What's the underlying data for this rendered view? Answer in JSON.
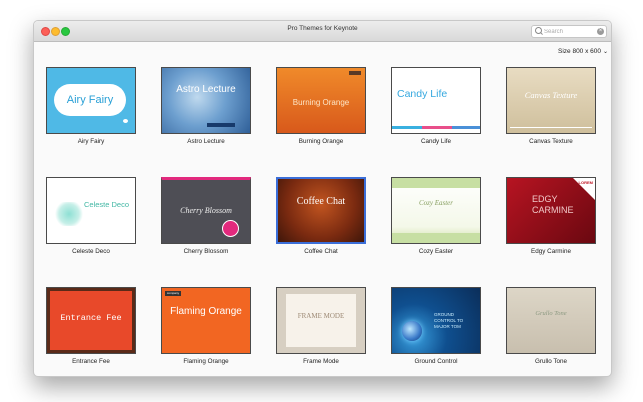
{
  "window": {
    "title": "Pro Themes for Keynote"
  },
  "search": {
    "placeholder": "Search"
  },
  "size_selector": {
    "label": "Size 800 x 600"
  },
  "themes": [
    {
      "name": "Airy Fairy",
      "slide_text": "Airy Fairy"
    },
    {
      "name": "Astro Lecture",
      "slide_text": "Astro Lecture"
    },
    {
      "name": "Burning Orange",
      "slide_text": "Burning Orange"
    },
    {
      "name": "Candy Life",
      "slide_text": "Candy Life"
    },
    {
      "name": "Canvas Texture",
      "slide_text": "Canvas Texture"
    },
    {
      "name": "Celeste Deco",
      "slide_text": "Celeste Deco"
    },
    {
      "name": "Cherry Blossom",
      "slide_text": "Cherry Blossom"
    },
    {
      "name": "Coffee Chat",
      "slide_text": "Coffee Chat",
      "selected": true
    },
    {
      "name": "Cozy Easter",
      "slide_text": "Cozy Easter"
    },
    {
      "name": "Edgy Carmine",
      "slide_text": "EDGY CARMINE",
      "corner_label": "LOREM"
    },
    {
      "name": "Entrance Fee",
      "slide_text": "Entrance Fee"
    },
    {
      "name": "Flaming Orange",
      "slide_text": "Flaming Orange",
      "tag_label": "company"
    },
    {
      "name": "Frame Mode",
      "slide_text": "FRAME MODE"
    },
    {
      "name": "Ground Control",
      "slide_text": "GROUND CONTROL TO MAJOR TOM"
    },
    {
      "name": "Grullo Tone",
      "slide_text": "Grullo Tone"
    }
  ],
  "colors": {
    "selection_border": "#3b6ed8",
    "close": "#fc5f57",
    "minimize": "#fdbc2e",
    "zoom": "#28c840"
  },
  "icons": {
    "search": "magnifier",
    "clear": "x-circle",
    "size_chevron": "chevron-down"
  }
}
